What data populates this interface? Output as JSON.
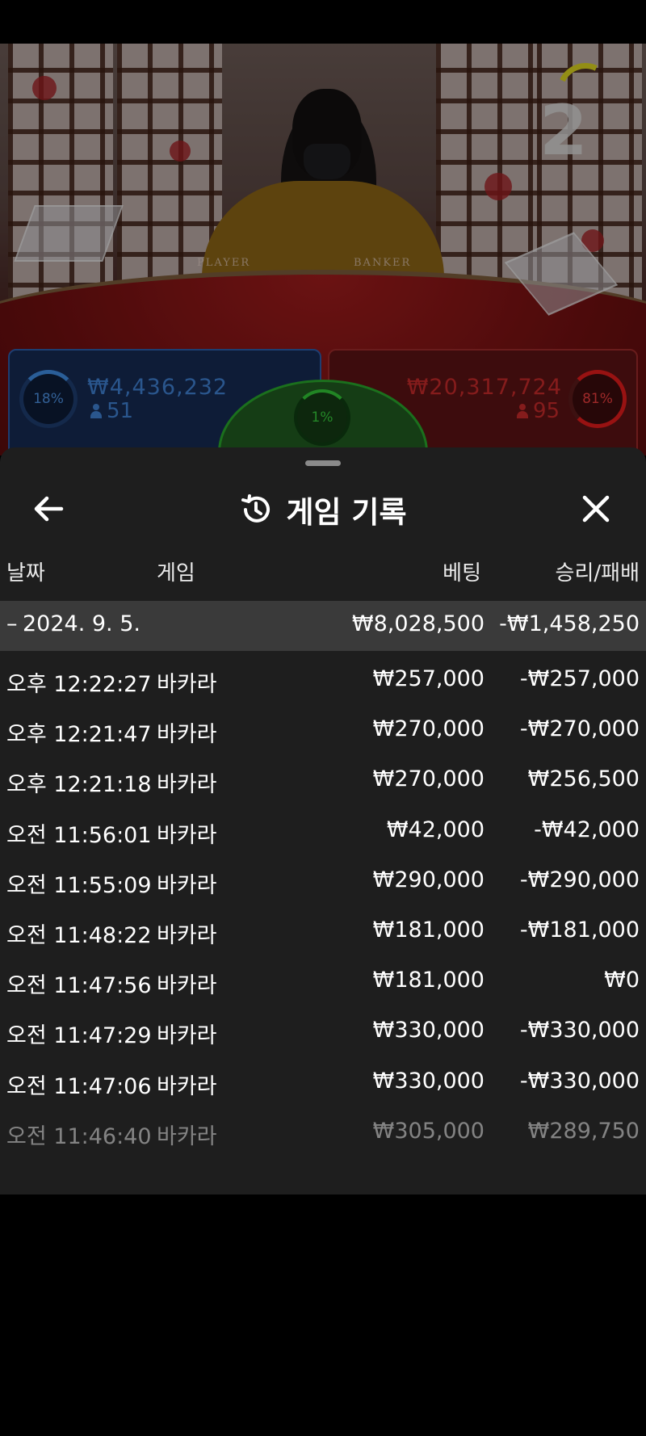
{
  "live": {
    "countdown": "2",
    "table_player_label": "PLAYER",
    "table_banker_label": "BANKER",
    "player": {
      "percent": "18%",
      "amount": "₩4,436,232",
      "count": "51"
    },
    "banker": {
      "percent": "81%",
      "amount": "₩20,317,724",
      "count": "95"
    },
    "tie": {
      "percent": "1%"
    }
  },
  "colors": {
    "player": "#4a8ede",
    "banker": "#e93d3d",
    "tie": "#35c73a",
    "timer": "#d9d11f"
  },
  "sheet": {
    "title": "게임 기록",
    "back_icon": "arrow-left-icon",
    "title_icon": "history-icon",
    "close_icon": "close-icon",
    "columns": {
      "date": "날짜",
      "game": "게임",
      "bet": "베팅",
      "result": "승리/패배"
    },
    "date_group": {
      "date": "2024. 9. 5.",
      "bet_total": "₩8,028,500",
      "result_total": "-₩1,458,250"
    },
    "rows": [
      {
        "time": "오후 12:22:27",
        "game": "바카라",
        "bet": "₩257,000",
        "result": "-₩257,000"
      },
      {
        "time": "오후 12:21:47",
        "game": "바카라",
        "bet": "₩270,000",
        "result": "-₩270,000"
      },
      {
        "time": "오후 12:21:18",
        "game": "바카라",
        "bet": "₩270,000",
        "result": "₩256,500"
      },
      {
        "time": "오전 11:56:01",
        "game": "바카라",
        "bet": "₩42,000",
        "result": "-₩42,000"
      },
      {
        "time": "오전 11:55:09",
        "game": "바카라",
        "bet": "₩290,000",
        "result": "-₩290,000"
      },
      {
        "time": "오전 11:48:22",
        "game": "바카라",
        "bet": "₩181,000",
        "result": "-₩181,000"
      },
      {
        "time": "오전 11:47:56",
        "game": "바카라",
        "bet": "₩181,000",
        "result": "₩0"
      },
      {
        "time": "오전 11:47:29",
        "game": "바카라",
        "bet": "₩330,000",
        "result": "-₩330,000"
      },
      {
        "time": "오전 11:47:06",
        "game": "바카라",
        "bet": "₩330,000",
        "result": "-₩330,000"
      },
      {
        "time": "오전 11:46:40",
        "game": "바카라",
        "bet": "₩305,000",
        "result": "₩289,750"
      }
    ]
  }
}
